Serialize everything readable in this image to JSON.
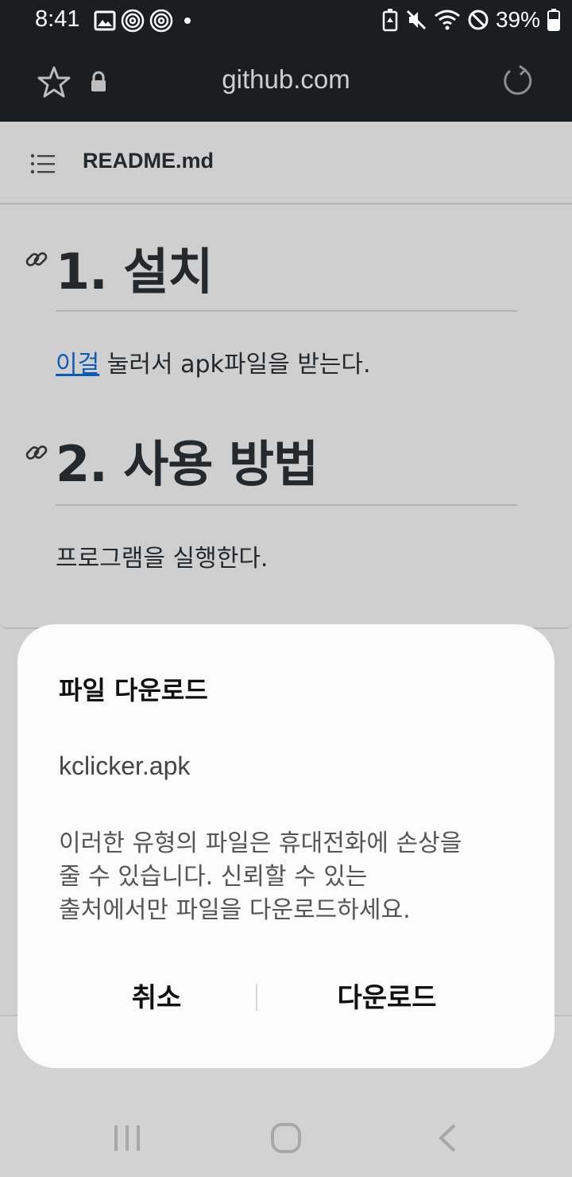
{
  "status_bar": {
    "time": "8:41",
    "battery": "39%",
    "left_icons": [
      "image-icon",
      "nfc-icon",
      "nfc-icon",
      "dot-icon"
    ],
    "right_icons": [
      "battery-saver-icon",
      "mute-icon",
      "wifi-icon",
      "do-not-disturb-icon",
      "battery-icon"
    ]
  },
  "browser": {
    "url": "github.com"
  },
  "readme": {
    "filename": "README.md",
    "section1": {
      "heading": "1. 설치",
      "link_text": "이걸",
      "text": " 눌러서 apk파일을 받는다."
    },
    "section2": {
      "heading": "2. 사용 방법",
      "text": "프로그램을 실행한다."
    }
  },
  "dialog": {
    "title": "파일 다운로드",
    "filename": "kclicker.apk",
    "message_line1": "이러한 유형의 파일은 휴대전화에 손상을",
    "message_line2": "줄 수 있습니다. 신뢰할 수 있는",
    "message_line3": "출처에서만 파일을 다운로드하세요.",
    "cancel_label": "취소",
    "download_label": "다운로드"
  },
  "colors": {
    "bar_bg": "#1b1e21",
    "page_bg": "#cfcfcf",
    "link": "#0a5cb8",
    "dialog_bg": "#fcfcfc"
  }
}
